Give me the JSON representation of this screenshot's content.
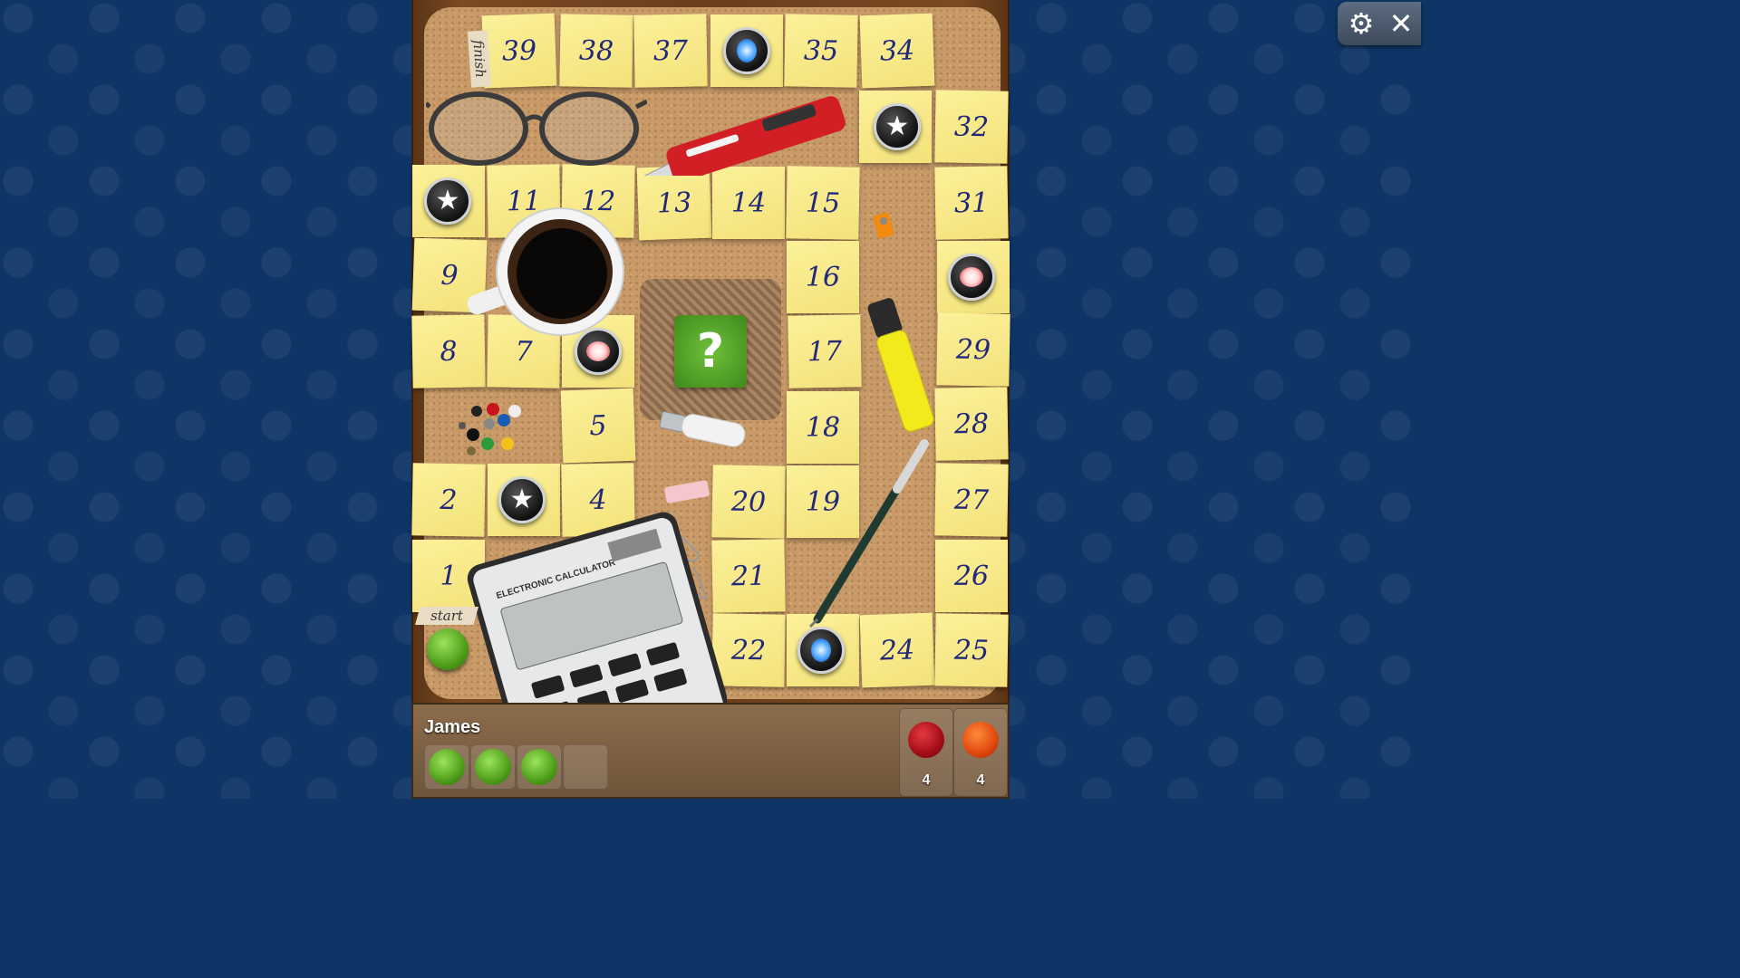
{
  "board": {
    "tiles": [
      {
        "n": "39"
      },
      {
        "n": "38"
      },
      {
        "n": "37"
      },
      {
        "n": "35"
      },
      {
        "n": "34"
      },
      {
        "n": "32"
      },
      {
        "n": "11"
      },
      {
        "n": "12"
      },
      {
        "n": "13"
      },
      {
        "n": "14"
      },
      {
        "n": "15"
      },
      {
        "n": "31"
      },
      {
        "n": "9"
      },
      {
        "n": "16"
      },
      {
        "n": "8"
      },
      {
        "n": "7"
      },
      {
        "n": "17"
      },
      {
        "n": "29"
      },
      {
        "n": "5"
      },
      {
        "n": "18"
      },
      {
        "n": "28"
      },
      {
        "n": "2"
      },
      {
        "n": "4"
      },
      {
        "n": "20"
      },
      {
        "n": "19"
      },
      {
        "n": "27"
      },
      {
        "n": "1"
      },
      {
        "n": "21"
      },
      {
        "n": "26"
      },
      {
        "n": "22"
      },
      {
        "n": "24"
      },
      {
        "n": "25"
      }
    ],
    "finish_label": "finish",
    "start_label": "start",
    "mystery_label": "?"
  },
  "player": {
    "name": "James",
    "pieces_home": 3,
    "pieces_total": 4
  },
  "opponents": [
    {
      "color": "#c8121e",
      "count": "4"
    },
    {
      "color": "#f0560f",
      "count": "4"
    }
  ],
  "controls": {
    "settings_glyph": "⚙",
    "close_glyph": "✕"
  },
  "icons": {
    "star": "★",
    "green_pawn": "green-pawn",
    "blue_gem": "blue-gem",
    "red_gem": "red-gem"
  },
  "colors": {
    "background": "#0e3566",
    "note": "#f7e982",
    "note_text": "#22287a"
  }
}
